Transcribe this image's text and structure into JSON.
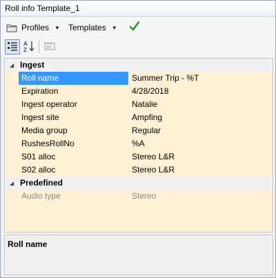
{
  "window": {
    "title": "Roll info Template_1"
  },
  "menubar": {
    "profiles_label": "Profiles",
    "templates_label": "Templates"
  },
  "toolbar": {
    "categorized": "categorized-view-icon",
    "alphabetical": "sort-az-icon",
    "property_pages": "property-pages-icon"
  },
  "grid": {
    "categories": [
      {
        "label": "Ingest",
        "properties": [
          {
            "name": "Roll name",
            "value": "Summer Trip - %T"
          },
          {
            "name": "Expiration",
            "value": "4/28/2018"
          },
          {
            "name": "Ingest operator",
            "value": "Natalie"
          },
          {
            "name": "Ingest site",
            "value": "Ampfing"
          },
          {
            "name": "Media group",
            "value": "Regular"
          },
          {
            "name": "RushesRollNo",
            "value": "%A"
          },
          {
            "name": "S01 alloc",
            "value": "Stereo L&R"
          },
          {
            "name": "S02 alloc",
            "value": "Stereo L&R"
          }
        ]
      },
      {
        "label": "Predefined",
        "properties": [
          {
            "name": "Audio type",
            "value": "Stereo"
          }
        ]
      }
    ]
  },
  "description": {
    "title": "Roll name"
  },
  "colors": {
    "grid_bg": "#fdf0d4",
    "selected": "#3399ff",
    "apply_check": "#1a9a1a"
  }
}
